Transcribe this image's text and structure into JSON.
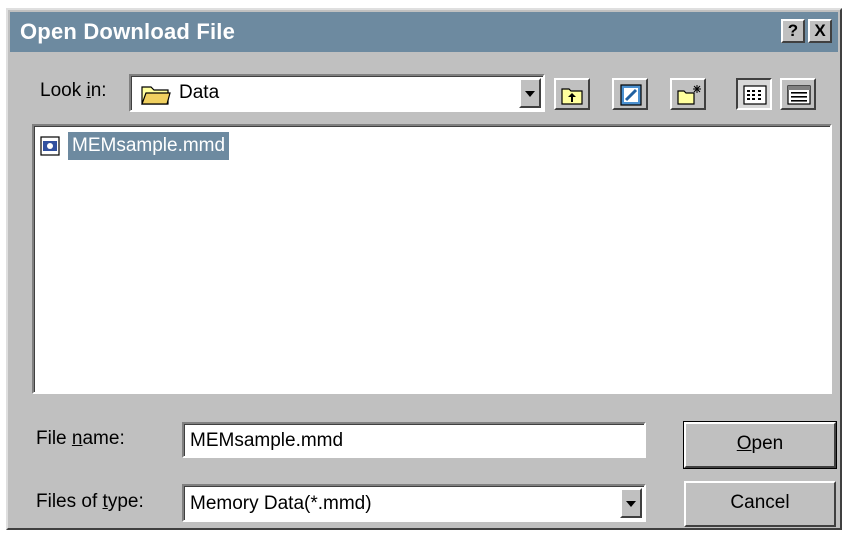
{
  "window": {
    "title": "Open Download File",
    "help_label": "?",
    "close_label": "X"
  },
  "lookin": {
    "label_pre": "Look ",
    "label_key": "i",
    "label_post": "n:",
    "value": "Data"
  },
  "toolbar": [
    "up-one-level",
    "view-desktop",
    "create-new-folder",
    "list-view",
    "details-view"
  ],
  "files": [
    {
      "name": "MEMsample.mmd",
      "selected": true
    }
  ],
  "filename": {
    "label_pre": "File ",
    "label_key": "n",
    "label_post": "ame:",
    "value": "MEMsample.mmd"
  },
  "filetype": {
    "label_pre": "Files of ",
    "label_key": "t",
    "label_post": "ype:",
    "value": "Memory Data(*.mmd)"
  },
  "buttons": {
    "open_key": "O",
    "open_rest": "pen",
    "cancel": "Cancel"
  },
  "colors": {
    "titlebar": "#6d8aa0",
    "face": "#c0c0c0",
    "selection": "#6d8aa0"
  }
}
